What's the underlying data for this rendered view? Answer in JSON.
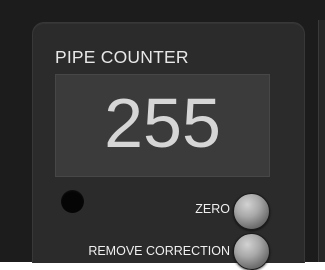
{
  "counter": {
    "title": "PIPE COUNTER",
    "value": "255"
  },
  "controls": {
    "zero_label": "ZERO",
    "remove_correction_label": "REMOVE CORRECTION"
  },
  "indicator": {
    "state": "off",
    "color": "#050505"
  },
  "colors": {
    "panel": "#2b2b2b",
    "display": "#3b3b3b",
    "text": "#e8e8e8"
  }
}
